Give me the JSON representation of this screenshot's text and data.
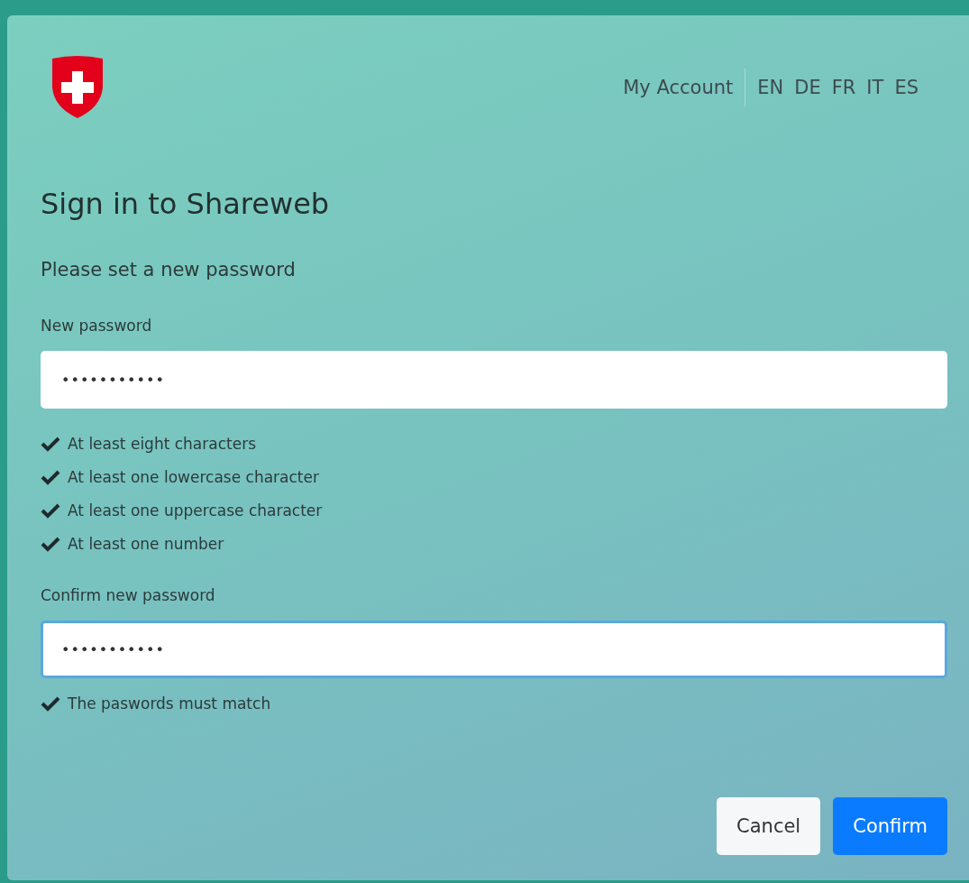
{
  "header": {
    "account_link": "My Account",
    "languages": [
      "EN",
      "DE",
      "FR",
      "IT",
      "ES"
    ]
  },
  "title": "Sign in to Shareweb",
  "subtitle": "Please set a new password",
  "fields": [
    {
      "label": "New password",
      "value": "•••••••••••",
      "focused": false,
      "rules": [
        {
          "text": "At least eight characters",
          "met": true
        },
        {
          "text": "At least one lowercase character",
          "met": true
        },
        {
          "text": "At least one uppercase character",
          "met": true
        },
        {
          "text": "At least one number",
          "met": true
        }
      ]
    },
    {
      "label": "Confirm new password",
      "value": "•••••••••••",
      "focused": true,
      "rules": [
        {
          "text": "The paswords must match",
          "met": true
        }
      ]
    }
  ],
  "buttons": [
    {
      "label": "Cancel",
      "kind": "secondary"
    },
    {
      "label": "Confirm",
      "kind": "primary"
    }
  ]
}
